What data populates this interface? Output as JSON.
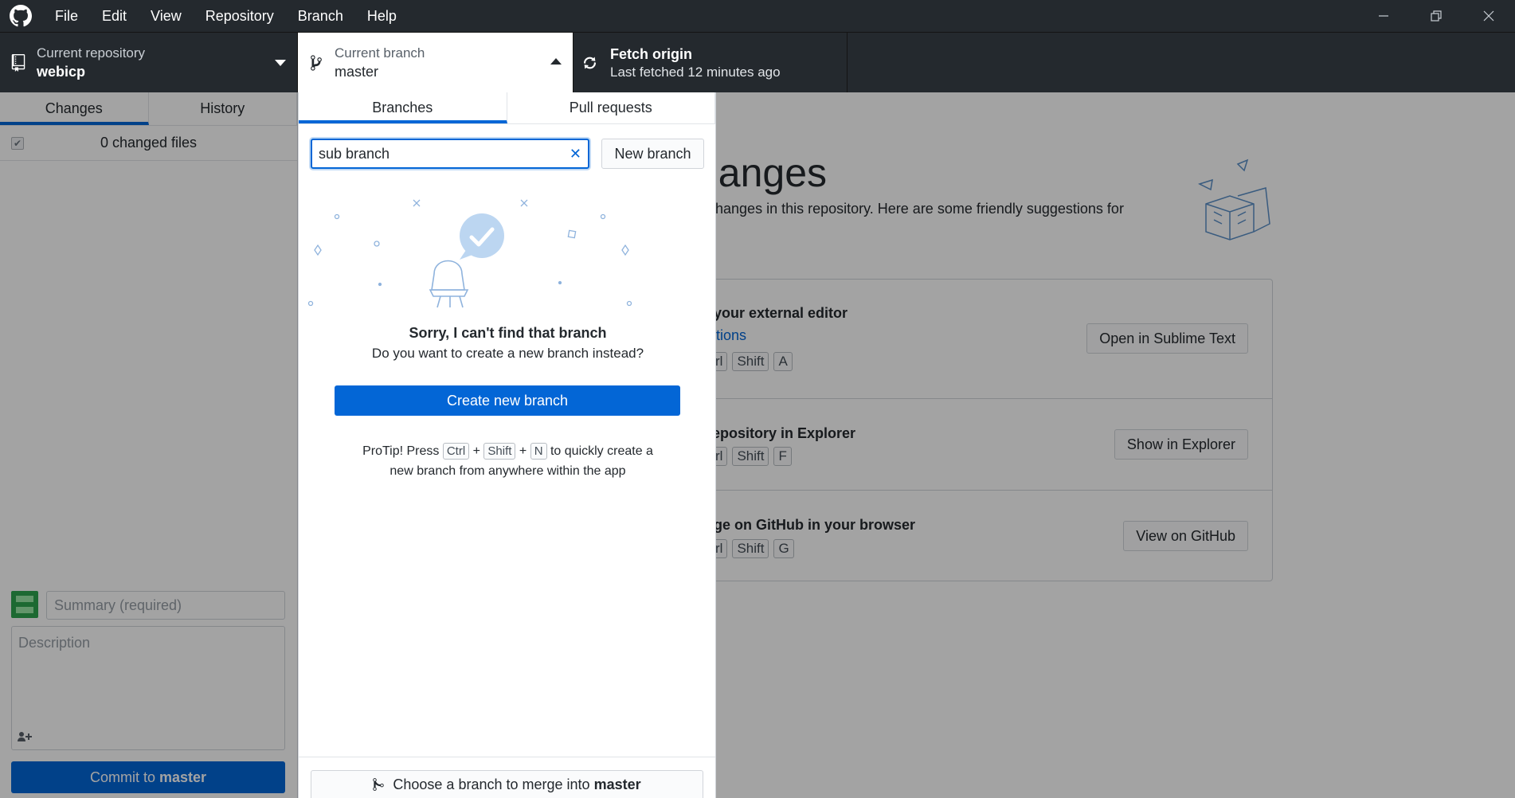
{
  "menu": [
    "File",
    "Edit",
    "View",
    "Repository",
    "Branch",
    "Help"
  ],
  "toolbar": {
    "repo_title": "Current repository",
    "repo_value": "webicp",
    "branch_title": "Current branch",
    "branch_value": "master",
    "fetch_title": "Fetch origin",
    "fetch_sub": "Last fetched 12 minutes ago"
  },
  "sidebar": {
    "tabs": [
      "Changes",
      "History"
    ],
    "changed_files": "0 changed files",
    "summary_placeholder": "Summary (required)",
    "description_placeholder": "Description",
    "commit_prefix": "Commit to",
    "commit_branch": "master"
  },
  "main": {
    "title": "hanges",
    "subtitle": "d changes in this repository. Here are some friendly suggestions for",
    "suggestions": [
      {
        "title": "in your external editor",
        "link": "Options",
        "keys": [
          "Ctrl",
          "Shift",
          "A"
        ],
        "button": "Open in Sublime Text"
      },
      {
        "title": "r repository in Explorer",
        "keys": [
          "Ctrl",
          "Shift",
          "F"
        ],
        "button": "Show in Explorer"
      },
      {
        "title": "page on GitHub in your browser",
        "keys": [
          "Ctrl",
          "Shift",
          "G"
        ],
        "button": "View on GitHub"
      }
    ]
  },
  "dropdown": {
    "tabs": [
      "Branches",
      "Pull requests"
    ],
    "filter_value": "sub branch",
    "new_branch": "New branch",
    "empty_title": "Sorry, I can't find that branch",
    "empty_sub": "Do you want to create a new branch instead?",
    "create_btn": "Create new branch",
    "protip_1": "ProTip! Press",
    "protip_keys": [
      "Ctrl",
      "Shift",
      "N"
    ],
    "protip_plus": "+",
    "protip_2": "to quickly create a",
    "protip_3": "new branch from anywhere within the app",
    "merge_prefix": "Choose a branch to merge into",
    "merge_branch": "master"
  },
  "colors": {
    "accent": "#0366d6",
    "titlebar": "#24292e"
  }
}
